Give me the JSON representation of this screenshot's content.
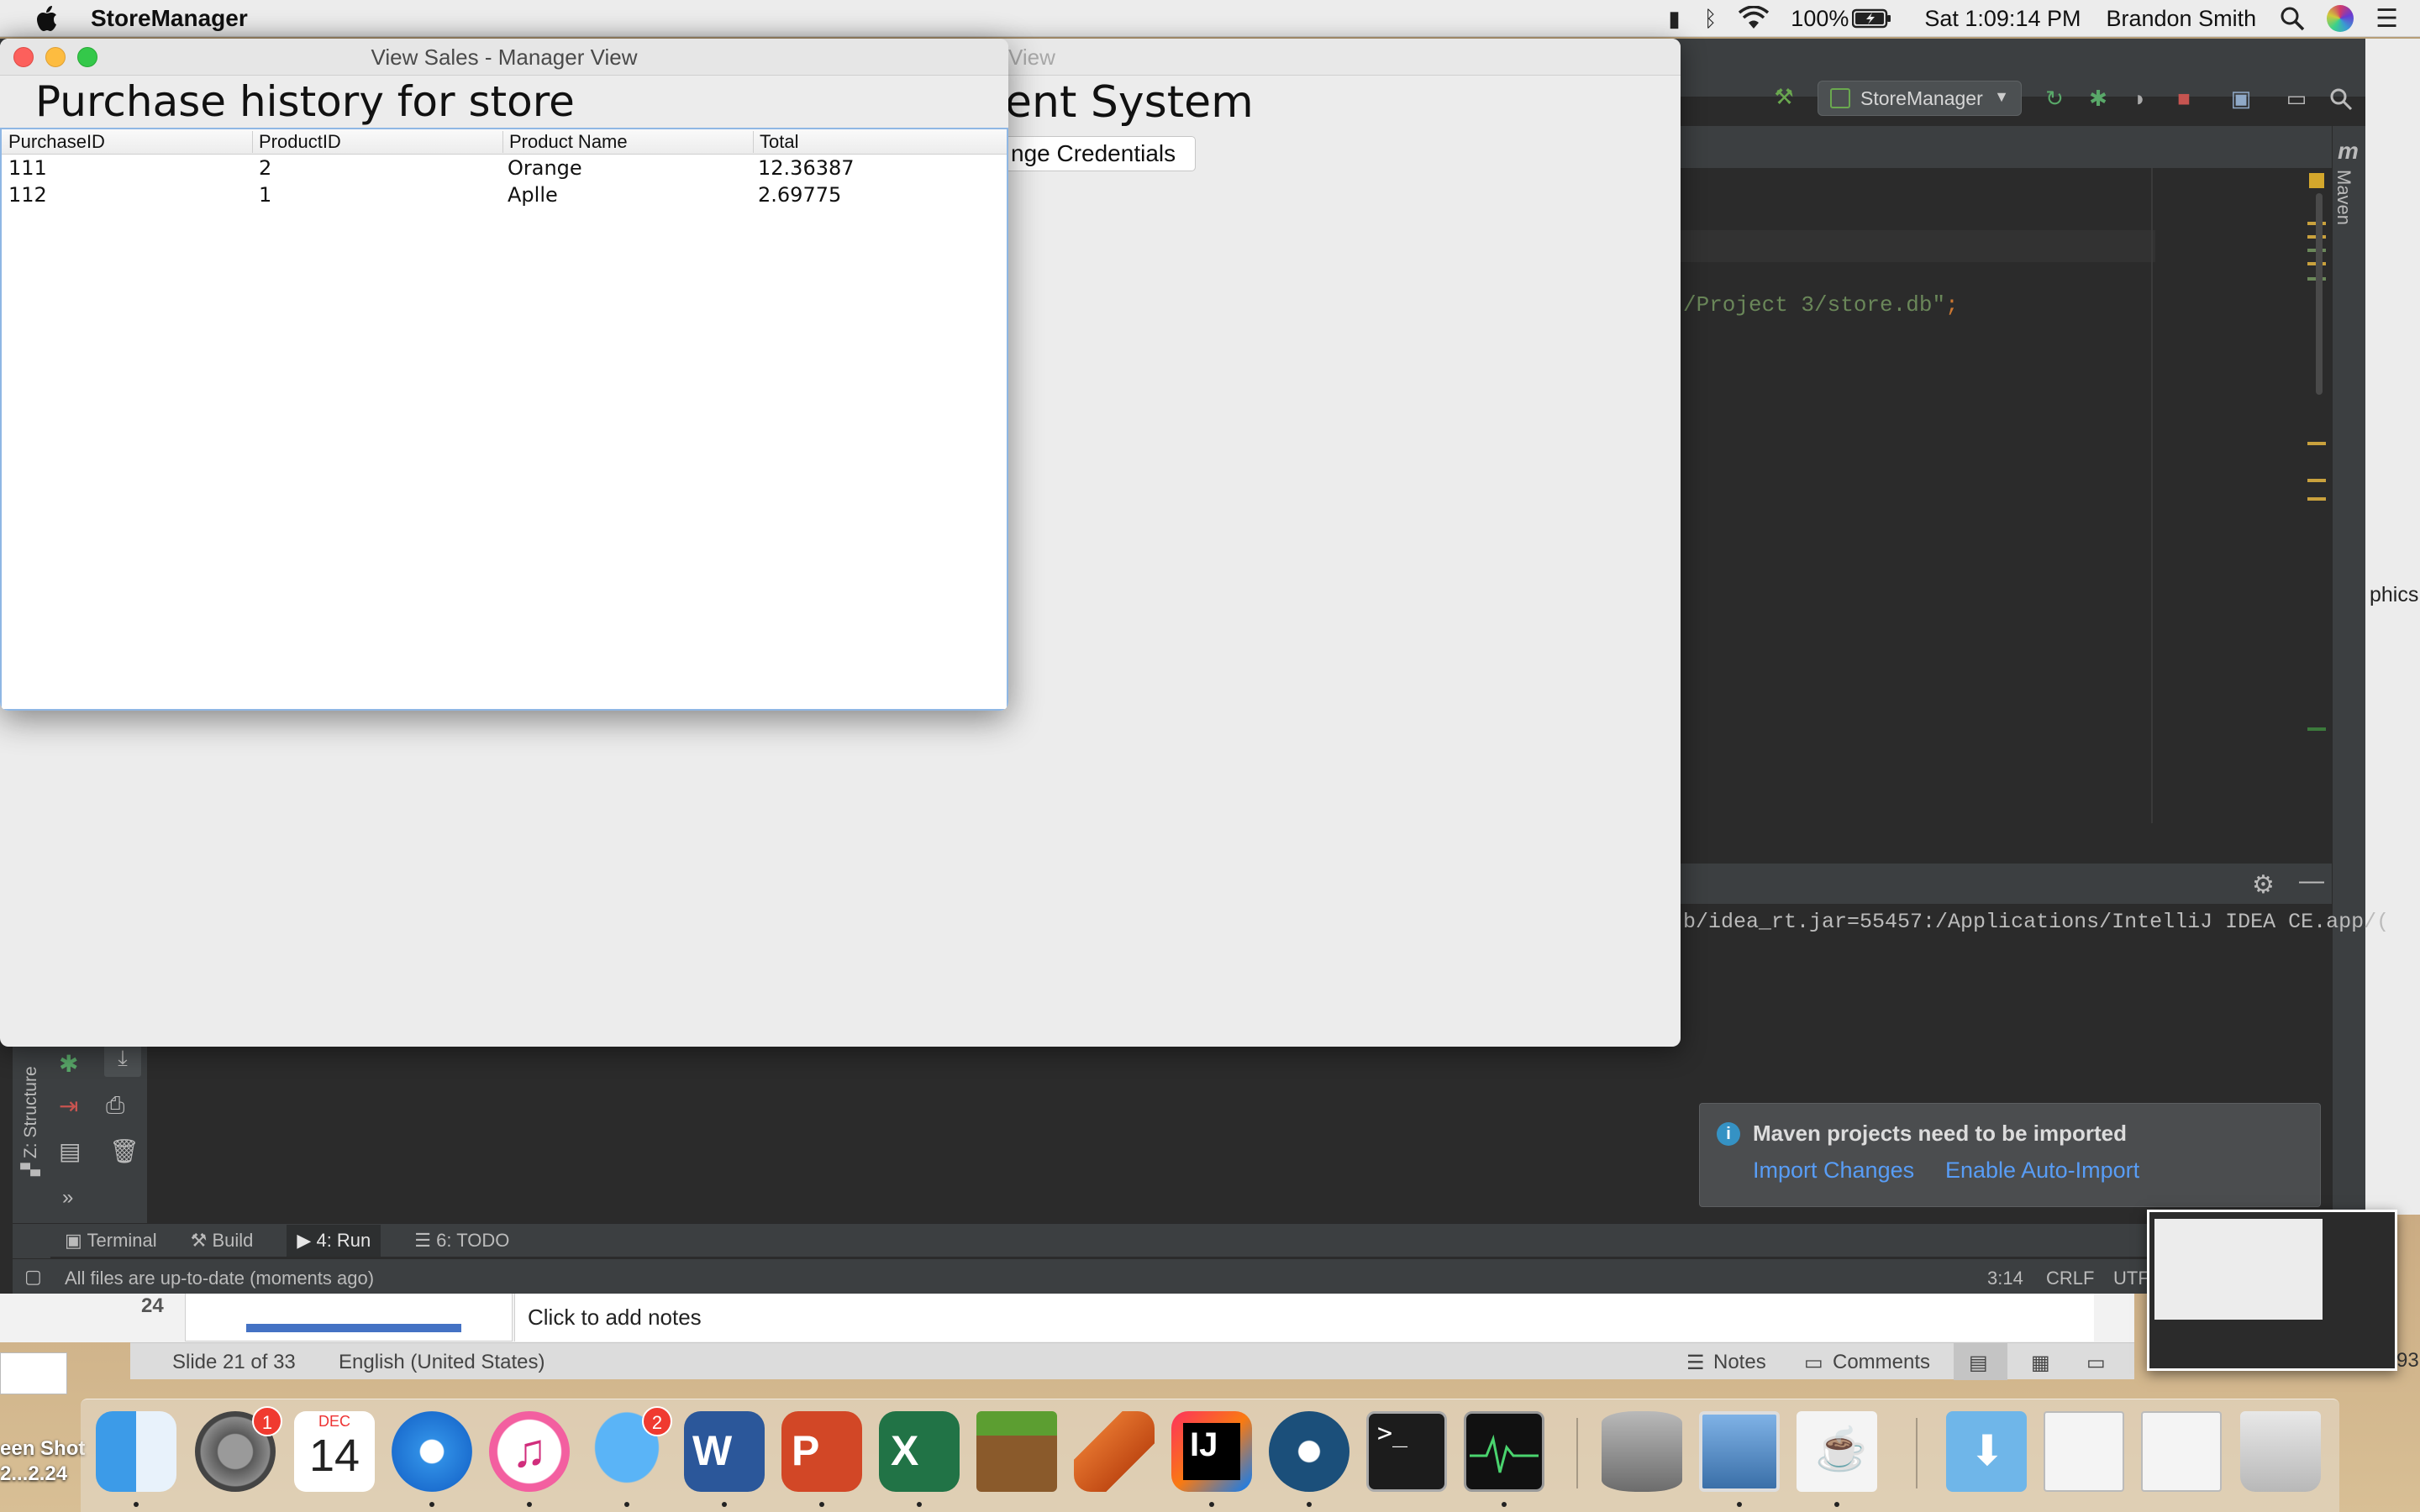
{
  "menubar": {
    "app_name": "StoreManager",
    "battery": "100%",
    "clock": "Sat 1:09:14 PM",
    "user": "Brandon Smith"
  },
  "sales_window": {
    "title": "View Sales - Manager View",
    "heading": "Purchase history for store",
    "columns": [
      "PurchaseID",
      "ProductID",
      "Product Name",
      "Total"
    ],
    "rows": [
      [
        "111",
        "2",
        "Orange",
        "12.36387"
      ],
      [
        "112",
        "1",
        "Aplle",
        "2.69775"
      ]
    ]
  },
  "main_window": {
    "title_fragment": "View",
    "heading_fragment": "ent System",
    "button_fragment": "nge Credentials"
  },
  "ide": {
    "run_config": "StoreManager",
    "code_fragment": "/Project 3/store.db\"",
    "code_semicolon": ";",
    "run_output": "b/idea_rt.jar=55457:/Applications/IntelliJ IDEA CE.app/(",
    "maven_label": "Maven",
    "structure_label": "Z: Structure",
    "tool_tabs": [
      "Terminal",
      "Build",
      "4: Run",
      "6: TODO"
    ],
    "status_message": "All files are up-to-date (moments ago)",
    "caret_position": "3:14",
    "line_separator": "CRLF",
    "encoding": "UTF",
    "notification": {
      "title": "Maven projects need to be imported",
      "import_link": "Import Changes",
      "auto_import_link": "Enable Auto-Import"
    },
    "right_fragment": "phics"
  },
  "powerpoint": {
    "slide_thumb_number": "24",
    "notes_placeholder": "Click to add notes",
    "slide_indicator": "Slide 21 of 33",
    "language": "English (United States)",
    "notes_button": "Notes",
    "comments_button": "Comments",
    "zoom_fragment": "93"
  },
  "desktop": {
    "file_label_line1": "een Shot",
    "file_label_line2": "2...2.24"
  },
  "dock": {
    "apps": [
      "Finder",
      "System Preferences",
      "Calendar",
      "Safari",
      "iTunes",
      "Messages",
      "Word",
      "PowerPoint",
      "Excel",
      "Minecraft",
      "MATLAB",
      "IntelliJ IDEA",
      "Steam",
      "Terminal",
      "Activity Monitor",
      "DB Browser",
      "Preview",
      "Java",
      "Downloads",
      "Window 1",
      "Window 2",
      "Trash"
    ],
    "system_prefs_badge": "1",
    "messages_badge": "2",
    "calendar_month": "DEC",
    "calendar_day": "14"
  }
}
